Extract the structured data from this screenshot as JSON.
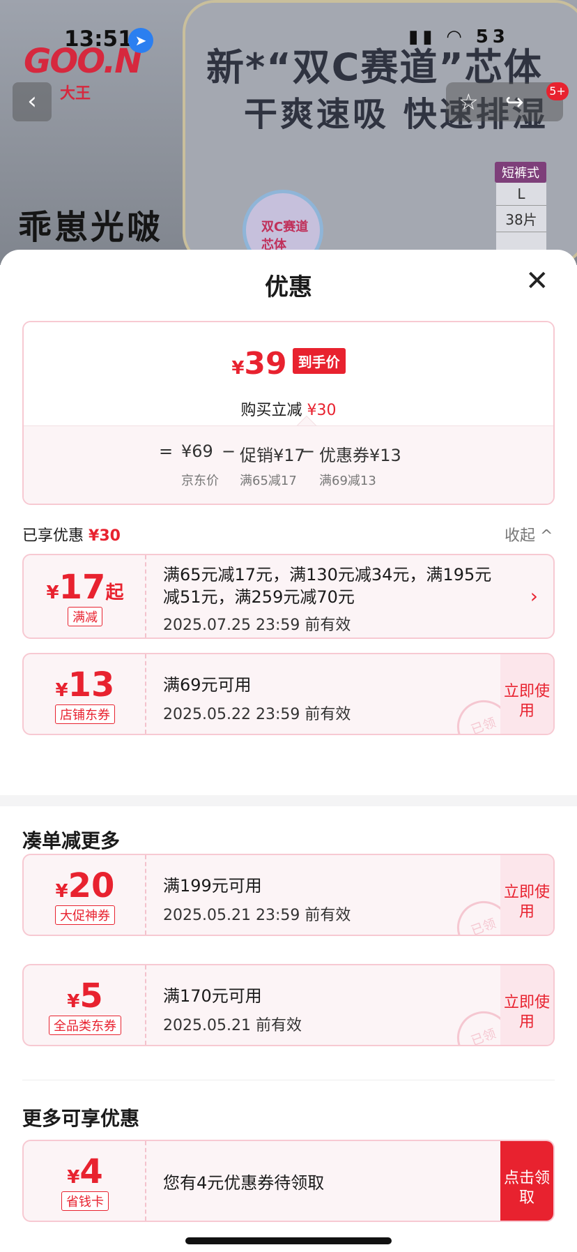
{
  "background": {
    "logo": "GOO.N",
    "logo_sub": "大王",
    "headline1": "新*“双C赛道”芯体",
    "headline2": "干爽速吸 快速排湿",
    "left_text": "乖崽光啵",
    "badge_text": "双C赛道 芯体",
    "size_tag": "短裤式",
    "size": "L",
    "count": "38片"
  },
  "status_bar": {
    "time": "13:51",
    "right": "▮▮ ◠ 53"
  },
  "top_bar": {
    "back_icon": "‹",
    "actions": "☆ ↪",
    "badge": "5+"
  },
  "sheet": {
    "title": "优惠",
    "close_icon": "✕",
    "final_price": {
      "currency": "¥",
      "amount": "39",
      "tag": "到手价"
    },
    "instant_discount": {
      "label": "购买立减",
      "amount": "¥30"
    },
    "formula": {
      "eq": "=",
      "jd_price": "¥69",
      "jd_price_label": "京东价",
      "minus1": "−",
      "promo": "促销¥17",
      "promo_label": "满65减17",
      "minus2": "−",
      "coupon": "优惠券¥13",
      "coupon_label": "满69减13"
    },
    "enjoyed": {
      "label": "已享优惠",
      "amount": "¥30"
    },
    "collapse": "收起 ^"
  },
  "coupons_applied": [
    {
      "currency": "¥",
      "amount": "17",
      "suffix": "起",
      "kind": "满减",
      "desc": "满65元减17元，满130元减34元，满195元减51元，满259元减70元",
      "valid": "2025.07.25 23:59 前有效",
      "action": "›"
    },
    {
      "currency": "¥",
      "amount": "13",
      "suffix": "",
      "kind": "店铺东券",
      "desc": "满69元可用",
      "valid": "2025.05.22 23:59 前有效",
      "action": "立即使用",
      "stamp": "已领"
    }
  ],
  "section_more": {
    "title": "凑单减更多"
  },
  "coupons_more": [
    {
      "currency": "¥",
      "amount": "20",
      "kind": "大促神券",
      "desc": "满199元可用",
      "valid": "2025.05.21 23:59 前有效",
      "action": "立即使用",
      "stamp": "已领"
    },
    {
      "currency": "¥",
      "amount": "5",
      "kind": "全品类东券",
      "desc": "满170元可用",
      "valid": "2025.05.21 前有效",
      "action": "立即使用",
      "stamp": "已领"
    }
  ],
  "section_extra": {
    "title": "更多可享优惠"
  },
  "coupon_extra": {
    "currency": "¥",
    "amount": "4",
    "kind": "省钱卡",
    "desc": "您有4元优惠券待领取",
    "action": "点击领取"
  }
}
